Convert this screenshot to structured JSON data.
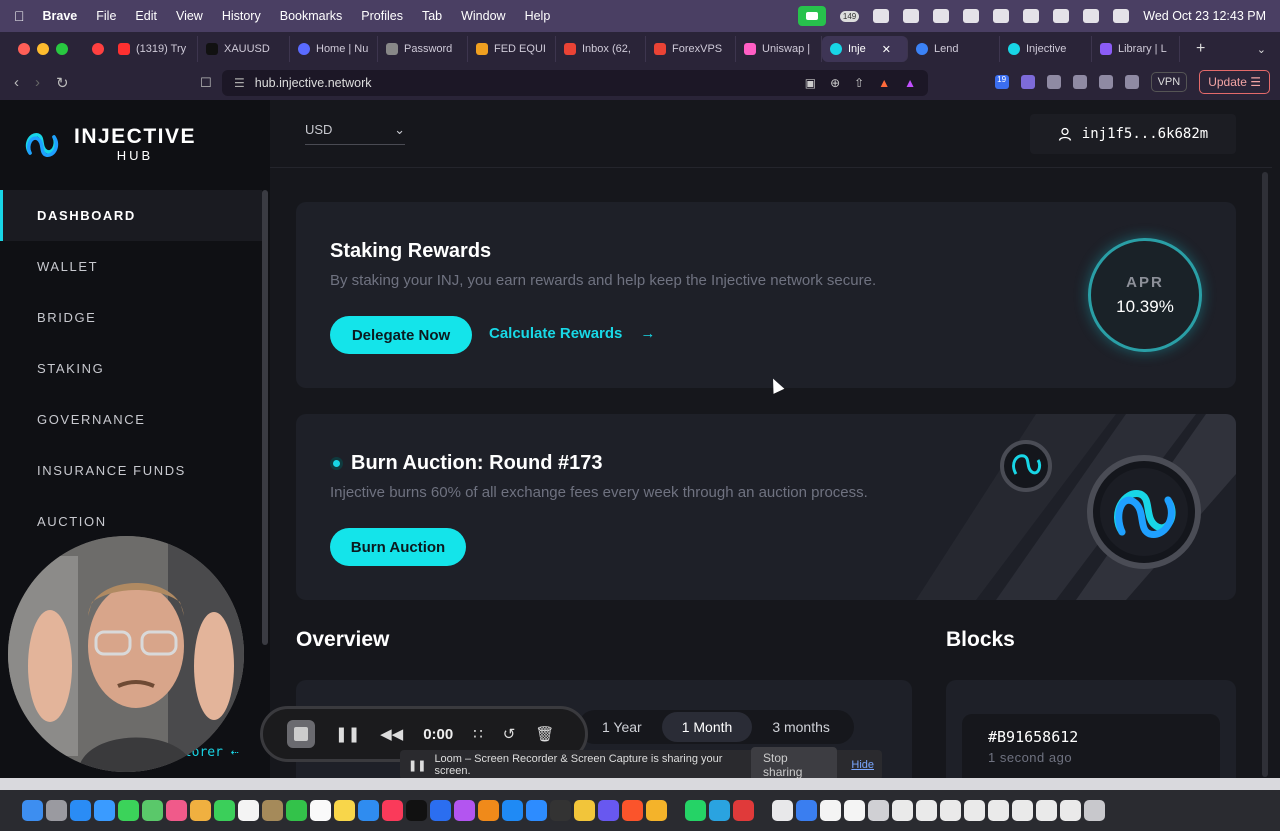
{
  "menubar": {
    "app_name": "Brave",
    "items": [
      "File",
      "Edit",
      "View",
      "History",
      "Bookmarks",
      "Profiles",
      "Tab",
      "Window",
      "Help"
    ],
    "tray_badge": "149",
    "datetime": "Wed Oct 23  12:43 PM"
  },
  "tabs": [
    {
      "label": "(1319) Try",
      "color": "#ff3030"
    },
    {
      "label": "XAUUSD",
      "color": "#222222"
    },
    {
      "label": "Home | Nu",
      "color": "#5a6bff"
    },
    {
      "label": "Password",
      "color": "#888888"
    },
    {
      "label": "FED EQUI",
      "color": "#f0a020"
    },
    {
      "label": "Inbox (62,",
      "color": "#ea4335"
    },
    {
      "label": "ForexVPS",
      "color": "#ea4335"
    },
    {
      "label": "Uniswap |",
      "color": "#ff5ec4"
    },
    {
      "label": "Inje",
      "color": "#18d6e6",
      "active": true
    },
    {
      "label": "Lend",
      "color": "#3b82f6"
    },
    {
      "label": "Injective",
      "color": "#18d6e6"
    },
    {
      "label": "Library | L",
      "color": "#8b5cf6"
    }
  ],
  "address": {
    "url": "hub.injective.network",
    "vpn": "VPN",
    "update": "Update",
    "ext_badge": "19"
  },
  "sidebar": {
    "logo_word1": "INJECTIVE",
    "logo_word2": "HUB",
    "items": [
      "DASHBOARD",
      "WALLET",
      "BRIDGE",
      "STAKING",
      "GOVERNANCE",
      "INSURANCE FUNDS",
      "AUCTION"
    ],
    "explorer_label": "plorer",
    "explorer_arrow": "⇠"
  },
  "header": {
    "currency": "USD",
    "account": "inj1f5...6k682m"
  },
  "staking": {
    "title": "Staking Rewards",
    "description": "By staking your INJ, you earn rewards and help keep the Injective network secure.",
    "delegate_button": "Delegate Now",
    "calculate_link": "Calculate Rewards",
    "apr_label": "APR",
    "apr_value": "10.39%"
  },
  "burn": {
    "title": "Burn Auction: Round #173",
    "description": "Injective burns 60% of all exchange fees every week through an auction process.",
    "button": "Burn Auction"
  },
  "overview": {
    "title": "Overview",
    "periods": [
      "1 Year",
      "1 Month",
      "3 months"
    ],
    "selected": "1 Month"
  },
  "blocks": {
    "title": "Blocks",
    "latest_id": "#B91658612",
    "latest_ago": "1 second ago"
  },
  "loom": {
    "time": "0:00",
    "share_text": "Loom – Screen Recorder & Screen Capture is sharing your screen.",
    "stop_sharing": "Stop sharing",
    "hide": "Hide"
  },
  "colors": {
    "accent": "#18d6e6",
    "background": "#16171c",
    "card": "#1e2028",
    "sidebar": "#0f1014"
  }
}
